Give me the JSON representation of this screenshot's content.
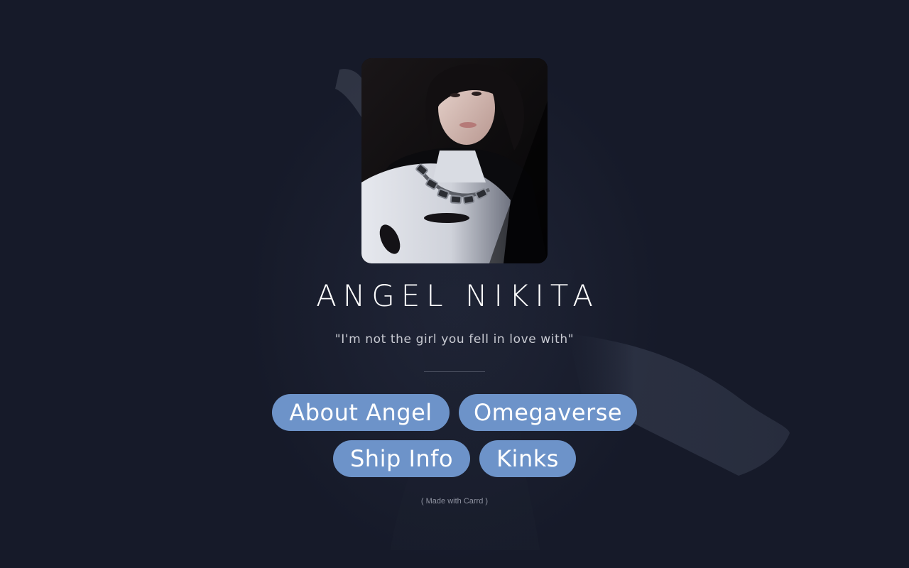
{
  "profile": {
    "image_alt": "portrait-photo",
    "title": "ANGEL NIKITA",
    "tagline": "\"I'm not the girl you fell in love with\""
  },
  "buttons": [
    {
      "label": "About Angel"
    },
    {
      "label": "Omegaverse"
    },
    {
      "label": "Ship Info"
    },
    {
      "label": "Kinks"
    }
  ],
  "footer": {
    "credit": "( Made with Carrd )"
  },
  "colors": {
    "background": "#161a29",
    "button": "#6d93c9",
    "title_text": "#ffffff",
    "tagline_text": "#c9cbd3",
    "credit_text": "#8e92a0"
  }
}
